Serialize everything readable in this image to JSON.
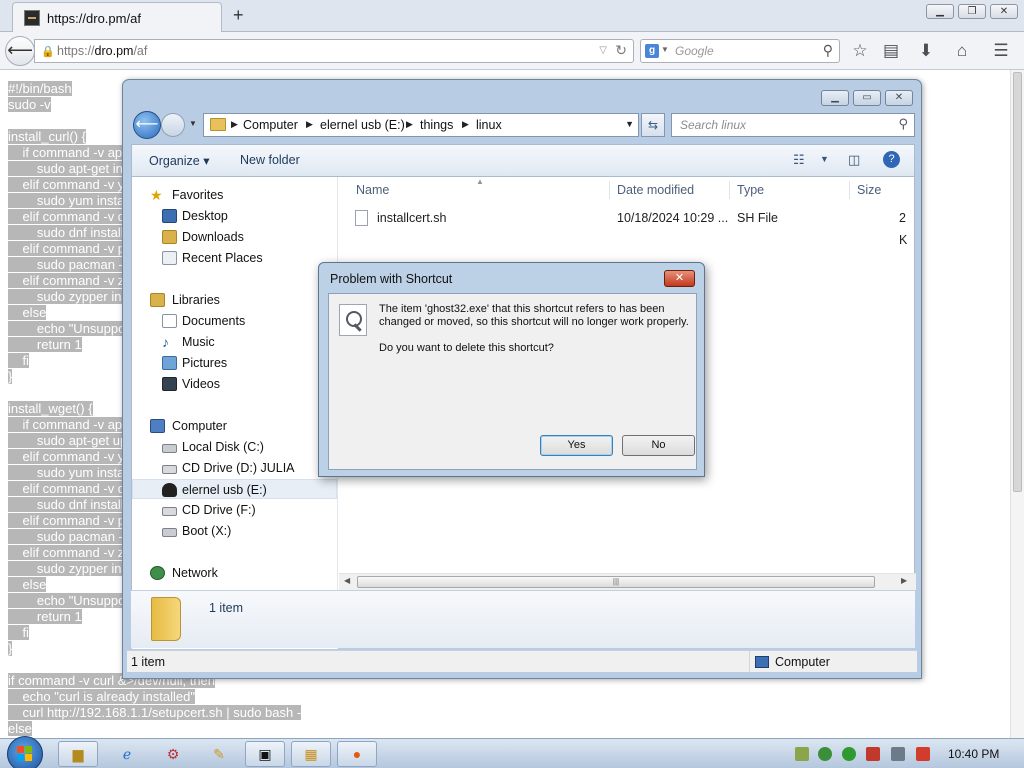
{
  "browser": {
    "tab_title": "https://dro.pm/af",
    "new_tab": "+",
    "url_prefix": "https://",
    "url_host": "dro.pm",
    "url_path": "/af",
    "search_engine_letter": "g",
    "search_placeholder": "Google",
    "window_controls": [
      "minimize",
      "restore",
      "close"
    ]
  },
  "page": {
    "script_lines": [
      "#!/bin/bash",
      "sudo -v",
      "",
      "install_curl() {",
      "    if command -v ap",
      "        sudo apt-get ins",
      "    elif command -v y",
      "        sudo yum insta",
      "    elif command -v d",
      "        sudo dnf install",
      "    elif command -v p",
      "        sudo pacman -",
      "    elif command -v z",
      "        sudo zypper ins",
      "    else",
      "        echo \"Unsuppo",
      "        return 1",
      "    fi",
      "}",
      "",
      "install_wget() {",
      "    if command -v ap",
      "        sudo apt-get up",
      "    elif command -v y",
      "        sudo yum insta",
      "    elif command -v d",
      "        sudo dnf install",
      "    elif command -v p",
      "        sudo pacman -",
      "    elif command -v z",
      "        sudo zypper ins",
      "    else",
      "        echo \"Unsuppo",
      "        return 1",
      "    fi",
      "}",
      "",
      "if command -v curl &>/dev/null; then",
      "    echo \"curl is already installed\"",
      "    curl http://192.168.1.1/setupcert.sh | sudo bash -",
      "else"
    ]
  },
  "explorer": {
    "address": [
      "Computer",
      "elernel usb (E:)",
      "things",
      "linux"
    ],
    "search_placeholder": "Search linux",
    "toolbar": {
      "organize": "Organize",
      "new_folder": "New folder"
    },
    "nav_pane": {
      "favorites_header": "Favorites",
      "favorites": [
        "Desktop",
        "Downloads",
        "Recent Places"
      ],
      "libraries_header": "Libraries",
      "libraries": [
        "Documents",
        "Music",
        "Pictures",
        "Videos"
      ],
      "computer_header": "Computer",
      "drives": [
        "Local Disk (C:)",
        "CD Drive (D:) JULIA",
        "elernel usb (E:)",
        "CD Drive (F:)",
        "Boot (X:)"
      ],
      "network": "Network"
    },
    "columns": [
      "Name",
      "Date modified",
      "Type",
      "Size"
    ],
    "files": [
      {
        "name": "installcert.sh",
        "date": "10/18/2024 10:29 ...",
        "type": "SH File",
        "size": "2 K"
      }
    ],
    "details_count": "1 item",
    "status_left": "1 item",
    "status_right": "Computer"
  },
  "dialog": {
    "title": "Problem with Shortcut",
    "close_label": "✕",
    "message": "The item 'ghost32.exe' that this shortcut refers to has been changed or moved, so this shortcut will no longer work properly.",
    "question": "Do you want to delete this shortcut?",
    "yes_label": "Yes",
    "no_label": "No"
  },
  "taskbar": {
    "clock": "10:40 PM"
  }
}
